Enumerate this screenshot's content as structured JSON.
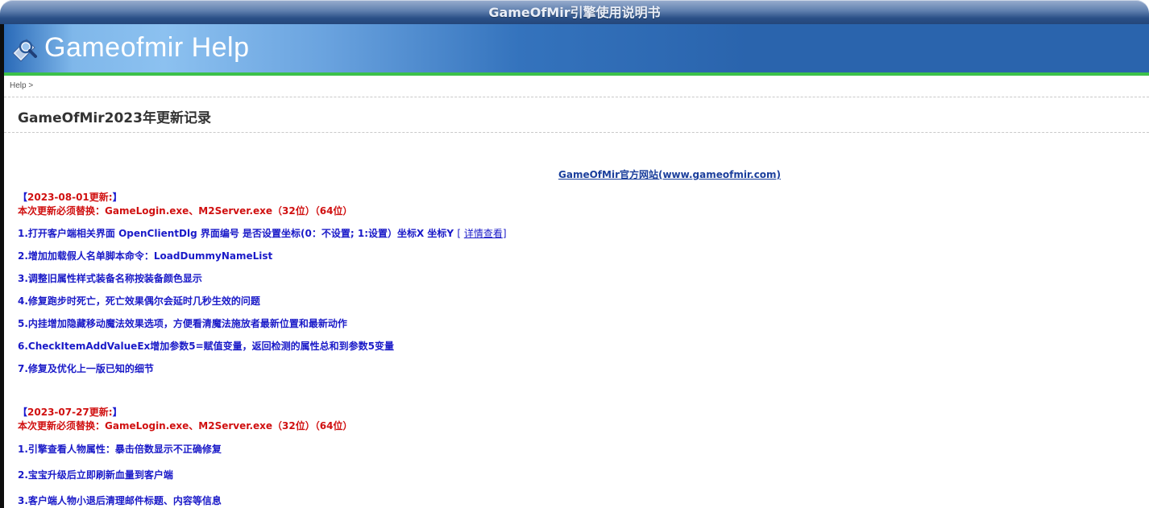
{
  "window": {
    "title": "GameOfMir引擎使用说明书"
  },
  "banner": {
    "app_title": "Gameofmir Help",
    "icon": "magnifier-icon"
  },
  "breadcrumb": {
    "text": "Help >"
  },
  "page": {
    "title": "GameOfMir2023年更新记录"
  },
  "content": {
    "site_link": "GameOfMir官方网站(www.gameofmir.com)",
    "sections": [
      {
        "bracket_open": "【",
        "date": "2023-08-01更新:",
        "bracket_close": "】",
        "replace": "本次更新必须替换：GameLogin.exe、M2Server.exe（32位）（64位）",
        "items": [
          "1.打开客户端相关界面 OpenClientDlg 界面编号 是否设置坐标(0：不设置; 1:设置）坐标X 坐标Y",
          "2.增加加载假人名单脚本命令：LoadDummyNameList",
          "3.调整旧属性样式装备名称按装备颜色显示",
          "4.修复跑步时死亡，死亡效果偶尔会延时几秒生效的问题",
          "5.内挂增加隐藏移动魔法效果选项，方便看清魔法施放者最新位置和最新动作",
          "6.CheckItemAddValueEx增加参数5=赋值变量，返回检测的属性总和到参数5变量",
          "7.修复及优化上一版已知的细节"
        ],
        "detail_open": "[ ",
        "detail_link": "详情查看",
        "detail_close": "]"
      },
      {
        "bracket_open": "【",
        "date": "2023-07-27更新:",
        "bracket_close": "】",
        "replace": "本次更新必须替换：GameLogin.exe、M2Server.exe（32位）（64位）",
        "items": [
          "1.引擎查看人物属性：暴击倍数显示不正确修复",
          "2.宝宝升级后立即刷新血量到客户端",
          "3.客户端人物小退后清理邮件标题、内容等信息"
        ]
      }
    ]
  }
}
